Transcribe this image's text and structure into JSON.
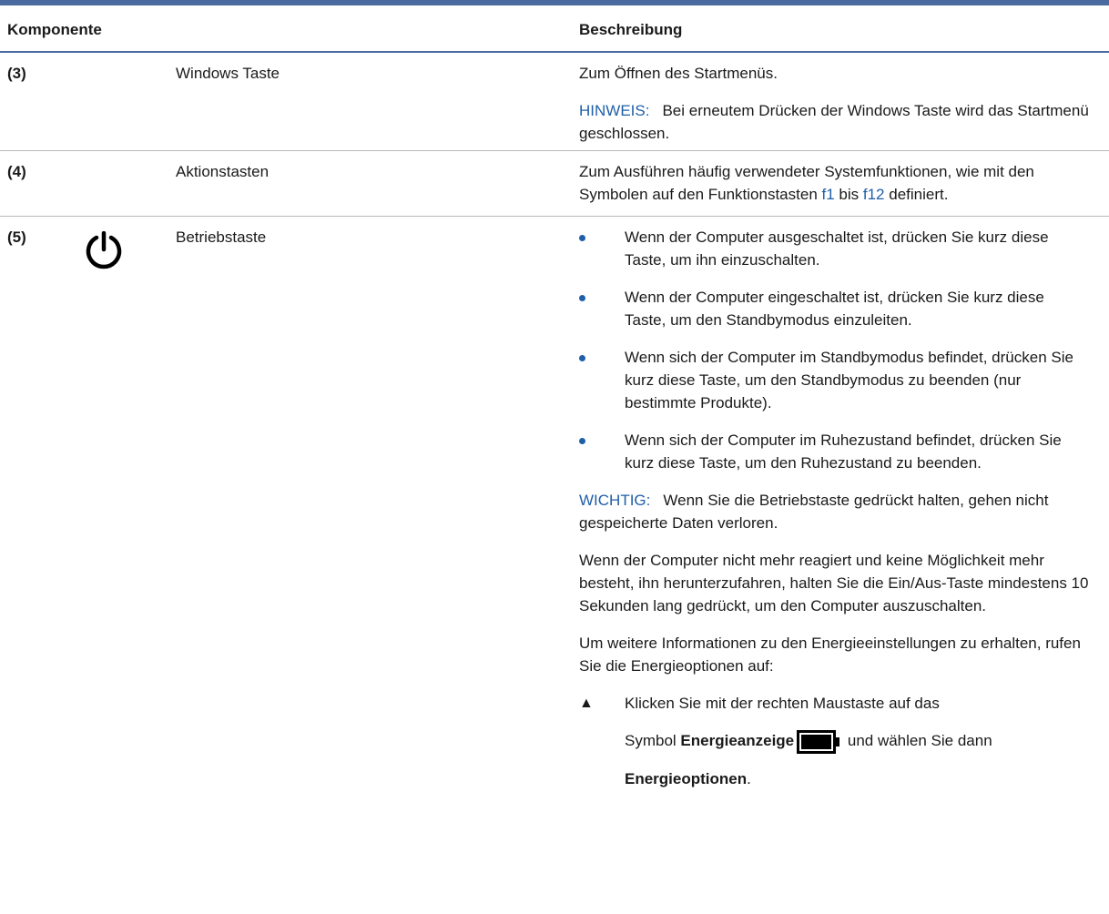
{
  "table": {
    "header": {
      "component": "Komponente",
      "description": "Beschreibung"
    },
    "rows": [
      {
        "num": "(3)",
        "name": "Windows Taste",
        "desc": "Zum Öffnen des Startmenüs.",
        "note_label": "HINWEIS:",
        "note_text": "Bei erneutem Drücken der Windows Taste wird das Startmenü geschlossen."
      },
      {
        "num": "(4)",
        "name": "Aktionstasten",
        "desc_prefix": "Zum Ausführen häufig verwendeter Systemfunktionen, wie mit den Symbolen auf den Funktionstasten ",
        "link_f1": "f1",
        "desc_mid": " bis ",
        "link_f12": "f12",
        "desc_suffix": " definiert."
      },
      {
        "num": "(5)",
        "icon": "power-icon",
        "name": "Betriebstaste",
        "bullets": [
          "Wenn der Computer ausgeschaltet ist, drücken Sie kurz diese Taste, um ihn einzuschalten.",
          "Wenn der Computer eingeschaltet ist, drücken Sie kurz diese Taste, um den Standbymodus einzuleiten.",
          "Wenn sich der Computer im Standbymodus befindet, drücken Sie kurz diese Taste, um den Standbymodus zu beenden (nur bestimmte Produkte).",
          "Wenn sich der Computer im Ruhezustand befindet, drücken Sie kurz diese Taste, um den Ruhezustand zu beenden."
        ],
        "important_label": "WICHTIG:",
        "important_text": "Wenn Sie die Betriebstaste gedrückt halten, gehen nicht gespeicherte Daten verloren.",
        "para1": "Wenn der Computer nicht mehr reagiert und keine Möglichkeit mehr besteht, ihn herunterzufahren, halten Sie die Ein/Aus-Taste mindestens 10 Sekunden lang gedrückt, um den Computer auszuschalten.",
        "para2": "Um weitere Informationen zu den Energieeinstellungen zu erhalten, rufen Sie die Energieoptionen auf:",
        "step_line1": "Klicken Sie mit der rechten Maustaste auf das",
        "step_symbol": "Symbol ",
        "step_bold1": "Energieanzeige",
        "step_after": " und wählen Sie dann",
        "step_bold2": "Energieoptionen",
        "step_end": "."
      }
    ]
  },
  "colors": {
    "accent": "#4a6aa0",
    "link": "#1f5fa8"
  }
}
